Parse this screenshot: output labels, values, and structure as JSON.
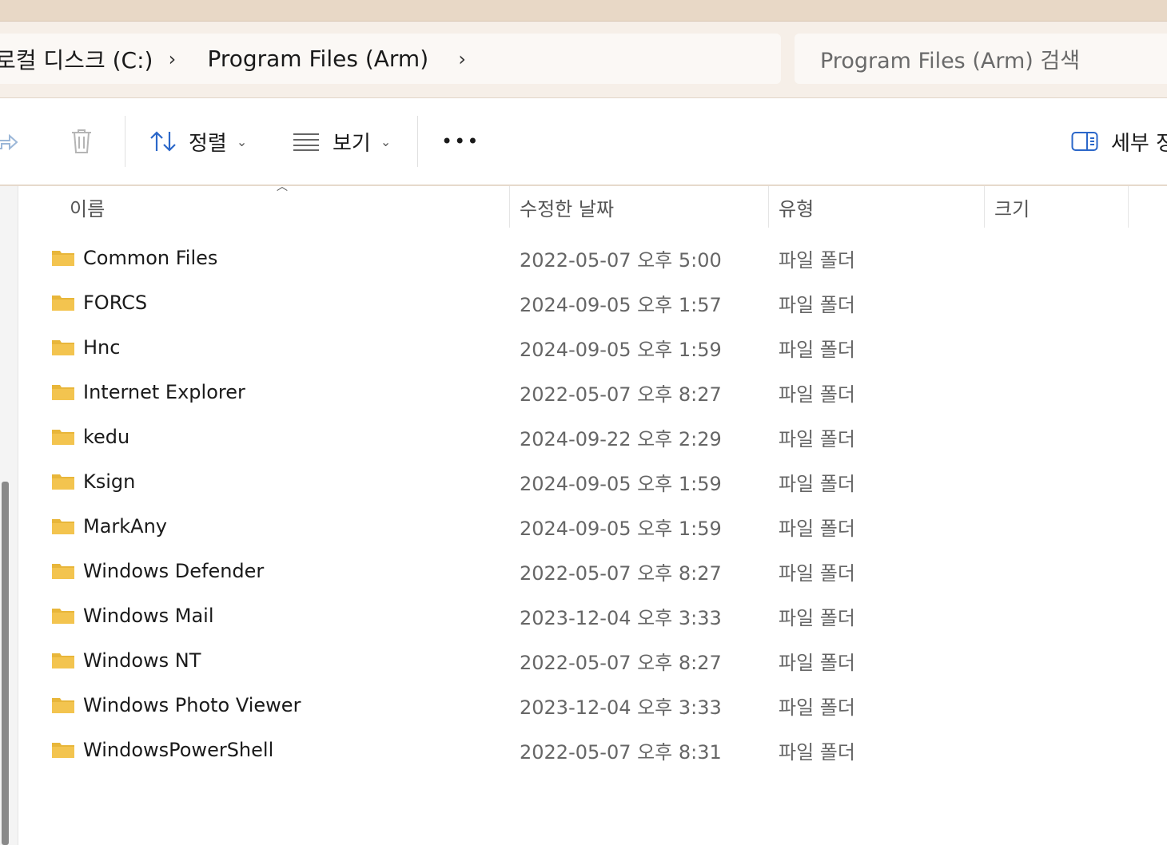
{
  "address": {
    "crumbs": [
      "로컬 디스크 (C:)",
      "Program Files (Arm)"
    ],
    "chevron": "›",
    "search_placeholder": "Program Files (Arm) 검색"
  },
  "toolbar": {
    "share_icon": "share-icon",
    "delete_icon": "trash-icon",
    "sort_label": "정렬",
    "view_label": "보기",
    "more_label": "•••",
    "details_label": "세부 정"
  },
  "columns": {
    "name": "이름",
    "date": "수정한 날짜",
    "type": "유형",
    "size": "크기"
  },
  "colors": {
    "folder": "#f3c44f",
    "accent": "#2b67c9",
    "address_bg": "#f6efe8"
  },
  "rows": [
    {
      "name": "Common Files",
      "date": "2022-05-07 오후 5:00",
      "type": "파일 폴더"
    },
    {
      "name": "FORCS",
      "date": "2024-09-05 오후 1:57",
      "type": "파일 폴더"
    },
    {
      "name": "Hnc",
      "date": "2024-09-05 오후 1:59",
      "type": "파일 폴더"
    },
    {
      "name": "Internet Explorer",
      "date": "2022-05-07 오후 8:27",
      "type": "파일 폴더"
    },
    {
      "name": "kedu",
      "date": "2024-09-22 오후 2:29",
      "type": "파일 폴더"
    },
    {
      "name": "Ksign",
      "date": "2024-09-05 오후 1:59",
      "type": "파일 폴더"
    },
    {
      "name": "MarkAny",
      "date": "2024-09-05 오후 1:59",
      "type": "파일 폴더"
    },
    {
      "name": "Windows Defender",
      "date": "2022-05-07 오후 8:27",
      "type": "파일 폴더"
    },
    {
      "name": "Windows Mail",
      "date": "2023-12-04 오후 3:33",
      "type": "파일 폴더"
    },
    {
      "name": "Windows NT",
      "date": "2022-05-07 오후 8:27",
      "type": "파일 폴더"
    },
    {
      "name": "Windows Photo Viewer",
      "date": "2023-12-04 오후 3:33",
      "type": "파일 폴더"
    },
    {
      "name": "WindowsPowerShell",
      "date": "2022-05-07 오후 8:31",
      "type": "파일 폴더"
    }
  ]
}
